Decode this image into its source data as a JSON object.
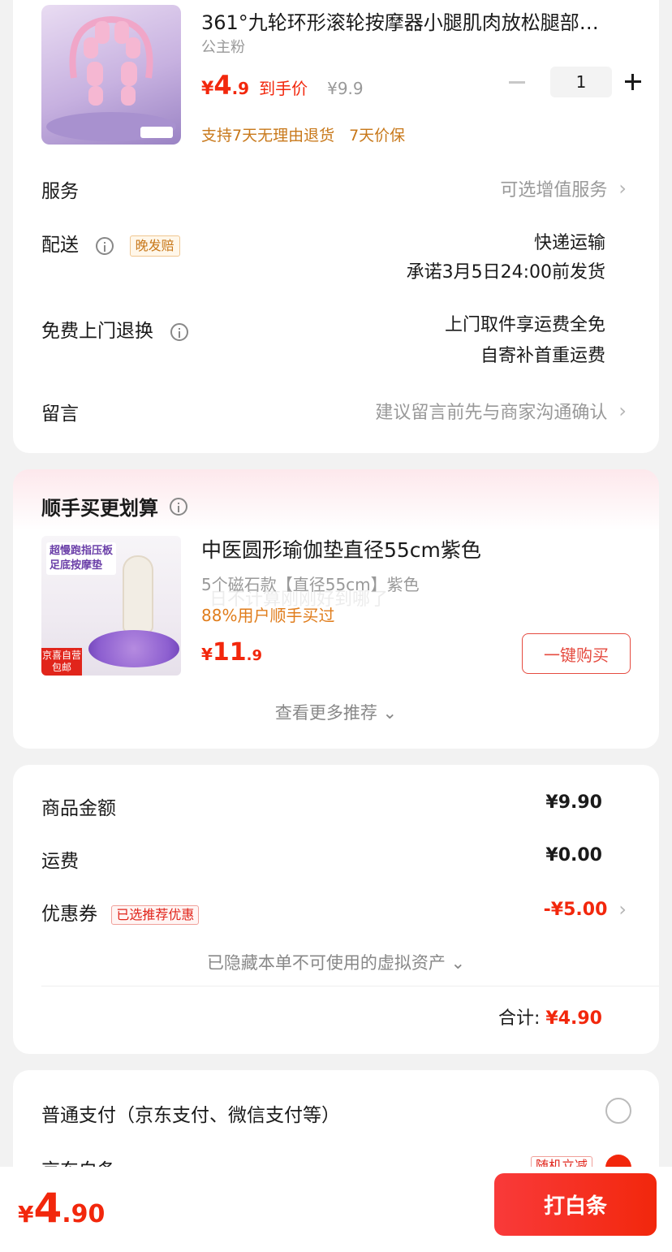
{
  "order_item": {
    "title": "361°九轮环形滚轮按摩器小腿肌肉放松腿部…",
    "spec": "公主粉",
    "image_label": "公主粉",
    "price_yen": "¥",
    "price_int": "4",
    "price_dec": ".9",
    "price_tag": "到手价",
    "original_price": "¥9.9",
    "quantity": "1",
    "support_return": "支持7天无理由退货",
    "support_price_protect": "7天价保"
  },
  "service": {
    "label": "服务",
    "value": "可选增值服务"
  },
  "delivery": {
    "label": "配送",
    "badge": "晚发赔",
    "method": "快递运输",
    "promise": "承诺3月5日24:00前发货"
  },
  "free_return": {
    "label": "免费上门退换",
    "line1": "上门取件享运费全免",
    "line2": "自寄补首重运费"
  },
  "message": {
    "label": "留言",
    "placeholder": "建议留言前先与商家沟通确认"
  },
  "recommend": {
    "section_title": "顺手买更划算",
    "title": "中医圆形瑜伽垫直径55cm紫色",
    "spec": "5个磁石款【直径55cm】紫色",
    "percent": "88%用户顺手买过",
    "price_yen": "¥",
    "price_int": "11",
    "price_dec": ".9",
    "buy_button": "一键购买",
    "more": "查看更多推荐",
    "image_banner_1": "超慢跑指压板",
    "image_banner_2": "足底按摩垫",
    "image_tag_1": "京喜自营",
    "image_tag_2": "包邮",
    "watermark": "日不计算刚刚好到哪了"
  },
  "amounts": {
    "goods_label": "商品金额",
    "goods_value": "¥9.90",
    "shipping_label": "运费",
    "shipping_value": "¥0.00",
    "coupon_label": "优惠券",
    "coupon_badge": "已选推荐优惠",
    "coupon_value": "-¥5.00",
    "hidden_assets": "已隐藏本单不可使用的虚拟资产",
    "total_label": "合计:",
    "total_value": "¥4.90"
  },
  "payment": {
    "normal_label": "普通支付（京东支付、微信支付等）",
    "baitiao_label": "京东白条",
    "baitiao_badge": "随机立减"
  },
  "bottom": {
    "price_yen": "¥",
    "price_int": "4",
    "price_dec": ".90",
    "pay_button": "打白条"
  },
  "colors": {
    "accent_red": "#f2270c",
    "orange": "#c8781a",
    "gray_text": "#999999"
  }
}
